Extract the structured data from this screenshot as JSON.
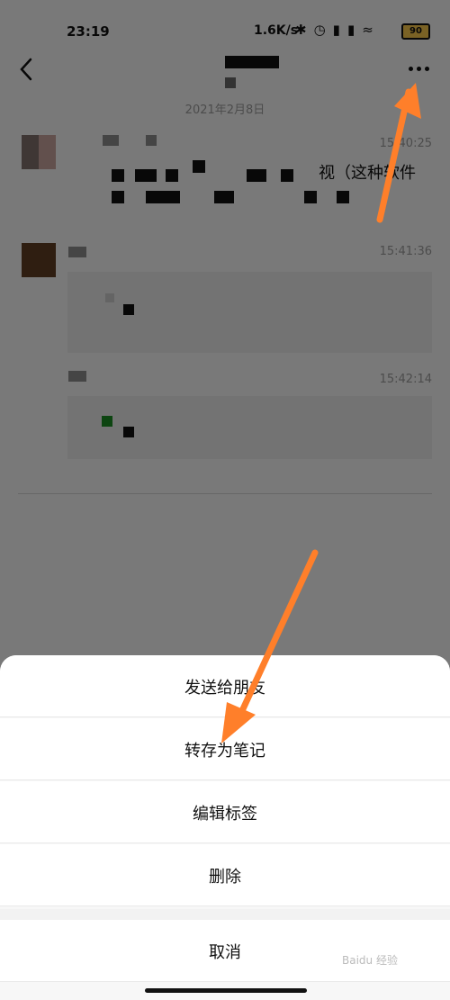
{
  "status_bar": {
    "time": "23:19",
    "network_speed": "1.6K/s",
    "battery": "90",
    "icons": [
      "bluetooth-icon",
      "alarm-icon",
      "signal-icon",
      "hd-signal-icon",
      "wifi-icon",
      "battery-icon"
    ]
  },
  "header": {
    "title": "",
    "date": "2021年2月8日"
  },
  "messages": [
    {
      "time": "15:40:25",
      "snippet": "视（这种软件"
    },
    {
      "time": "15:41:36"
    },
    {
      "time": "15:42:14"
    }
  ],
  "sheet": {
    "items": [
      "发送给朋友",
      "转存为笔记",
      "编辑标签",
      "删除"
    ],
    "cancel": "取消"
  },
  "watermark": "Baidu 经验"
}
